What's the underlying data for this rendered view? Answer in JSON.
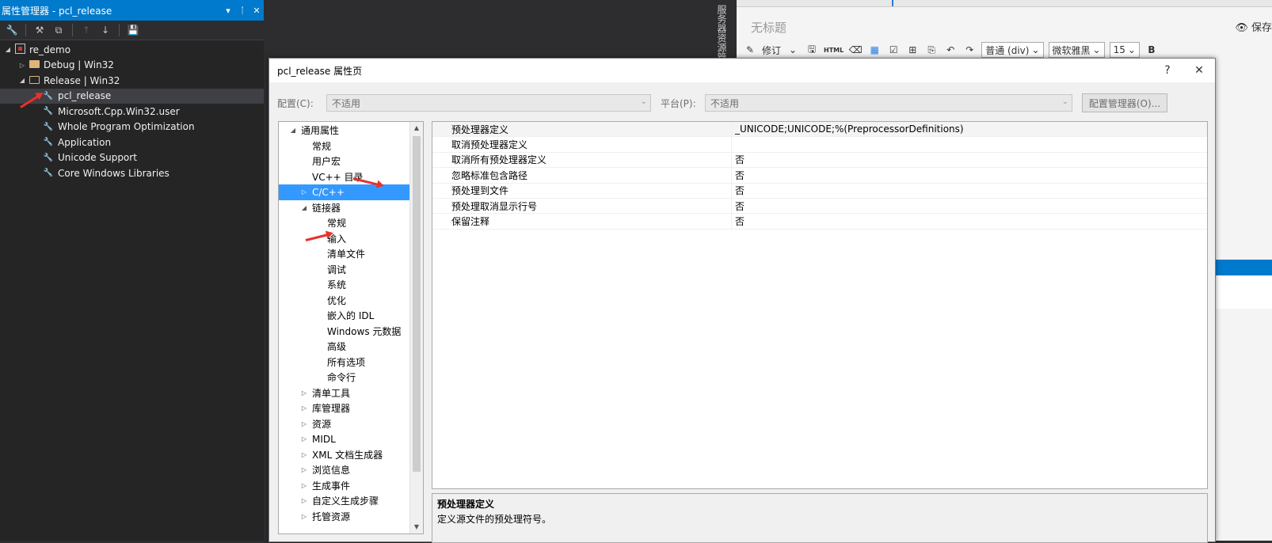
{
  "property_manager": {
    "title": "属性管理器 - pcl_release",
    "title_buttons": [
      "▾",
      "ᛙ",
      "✕"
    ],
    "toolbar": [
      "🔧",
      "⚒",
      "⧉",
      "↑",
      "↓",
      "💾"
    ],
    "tree": [
      {
        "label": "re_demo",
        "icon": "project-icon",
        "arrow": "◢",
        "indent": 0
      },
      {
        "label": "Debug | Win32",
        "icon": "folder-icon",
        "arrow": "▷",
        "indent": 1
      },
      {
        "label": "Release | Win32",
        "icon": "open-folder-icon",
        "arrow": "◢",
        "indent": 1
      },
      {
        "label": "pcl_release",
        "icon": "wrench-icon",
        "arrow": "",
        "indent": 2,
        "selected": true
      },
      {
        "label": "Microsoft.Cpp.Win32.user",
        "icon": "wrench-icon",
        "arrow": "",
        "indent": 2
      },
      {
        "label": "Whole Program Optimization",
        "icon": "wrench-icon",
        "arrow": "",
        "indent": 2
      },
      {
        "label": "Application",
        "icon": "wrench-icon",
        "arrow": "",
        "indent": 2
      },
      {
        "label": "Unicode Support",
        "icon": "wrench-icon",
        "arrow": "",
        "indent": 2
      },
      {
        "label": "Core Windows Libraries",
        "icon": "wrench-icon",
        "arrow": "",
        "indent": 2
      }
    ]
  },
  "side_tab": {
    "label": "服务器资源管"
  },
  "editor": {
    "doc_title": "无标题",
    "save_label": "👁 保存",
    "toolbar": {
      "revise": "修订",
      "html": "HTML",
      "format_select": "普通 (div)",
      "font_select": "微软雅黑",
      "size_select": "15",
      "bold": "B"
    }
  },
  "dialog": {
    "title": "pcl_release 属性页",
    "help_button": "?",
    "close_button": "✕",
    "config_label": "配置(C):",
    "config_value": "不适用",
    "platform_label": "平台(P):",
    "platform_value": "不适用",
    "config_manager_button": "配置管理器(O)...",
    "nav": [
      {
        "label": "通用属性",
        "arrow": "◢",
        "indent": 0
      },
      {
        "label": "常规",
        "arrow": "",
        "indent": 1
      },
      {
        "label": "用户宏",
        "arrow": "",
        "indent": 1
      },
      {
        "label": "VC++ 目录",
        "arrow": "",
        "indent": 1
      },
      {
        "label": "C/C++",
        "arrow": "▷",
        "indent": 1,
        "selected": true
      },
      {
        "label": "链接器",
        "arrow": "◢",
        "indent": 1
      },
      {
        "label": "常规",
        "arrow": "",
        "indent": 2
      },
      {
        "label": "输入",
        "arrow": "",
        "indent": 2
      },
      {
        "label": "清单文件",
        "arrow": "",
        "indent": 2
      },
      {
        "label": "调试",
        "arrow": "",
        "indent": 2
      },
      {
        "label": "系统",
        "arrow": "",
        "indent": 2
      },
      {
        "label": "优化",
        "arrow": "",
        "indent": 2
      },
      {
        "label": "嵌入的 IDL",
        "arrow": "",
        "indent": 2
      },
      {
        "label": "Windows 元数据",
        "arrow": "",
        "indent": 2
      },
      {
        "label": "高级",
        "arrow": "",
        "indent": 2
      },
      {
        "label": "所有选项",
        "arrow": "",
        "indent": 2
      },
      {
        "label": "命令行",
        "arrow": "",
        "indent": 2
      },
      {
        "label": "清单工具",
        "arrow": "▷",
        "indent": 1
      },
      {
        "label": "库管理器",
        "arrow": "▷",
        "indent": 1
      },
      {
        "label": "资源",
        "arrow": "▷",
        "indent": 1
      },
      {
        "label": "MIDL",
        "arrow": "▷",
        "indent": 1
      },
      {
        "label": "XML 文档生成器",
        "arrow": "▷",
        "indent": 1
      },
      {
        "label": "浏览信息",
        "arrow": "▷",
        "indent": 1
      },
      {
        "label": "生成事件",
        "arrow": "▷",
        "indent": 1
      },
      {
        "label": "自定义生成步骤",
        "arrow": "▷",
        "indent": 1
      },
      {
        "label": "托管资源",
        "arrow": "▷",
        "indent": 1
      }
    ],
    "properties": [
      {
        "name": "预处理器定义",
        "value": "_UNICODE;UNICODE;%(PreprocessorDefinitions)"
      },
      {
        "name": "取消预处理器定义",
        "value": ""
      },
      {
        "name": "取消所有预处理器定义",
        "value": "否"
      },
      {
        "name": "忽略标准包含路径",
        "value": "否"
      },
      {
        "name": "预处理到文件",
        "value": "否"
      },
      {
        "name": "预处理取消显示行号",
        "value": "否"
      },
      {
        "name": "保留注释",
        "value": "否"
      }
    ],
    "description_title": "预处理器定义",
    "description_text": "定义源文件的预处理符号。"
  },
  "colors": {
    "accent": "#007acc",
    "selection": "#3399ff",
    "annotation": "#e8312b"
  }
}
